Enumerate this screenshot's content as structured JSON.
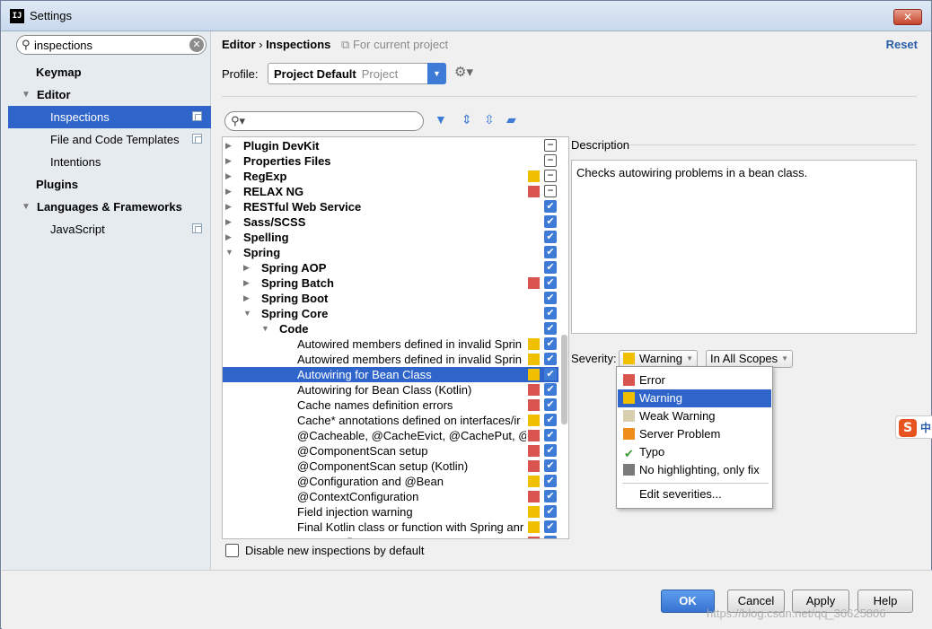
{
  "window": {
    "title": "Settings",
    "app_icon": "IJ",
    "close": "✕"
  },
  "left": {
    "search_value": "inspections",
    "items": [
      {
        "label": "Keymap"
      },
      {
        "label": "Editor"
      },
      {
        "label": "Inspections"
      },
      {
        "label": "File and Code Templates"
      },
      {
        "label": "Intentions"
      },
      {
        "label": "Plugins"
      },
      {
        "label": "Languages & Frameworks"
      },
      {
        "label": "JavaScript"
      }
    ]
  },
  "header": {
    "crumb_1": "Editor",
    "crumb_sep": "›",
    "crumb_2": "Inspections",
    "scope_note": "For current project",
    "reset": "Reset",
    "profile_label": "Profile:",
    "profile_value": "Project Default",
    "profile_kind": "Project"
  },
  "colors": {
    "error": "#d9534f",
    "warning": "#f0c000",
    "weak_warning": "#d8cfae",
    "server_problem": "#ee8c1c",
    "no_highlight": "#7a7a7a",
    "selection": "#2f65ca",
    "accent": "#3d7bd6"
  },
  "tree": [
    {
      "label": "Plugin DevKit",
      "sev": "",
      "check": "part"
    },
    {
      "label": "Properties Files",
      "sev": "",
      "check": "part"
    },
    {
      "label": "RegExp",
      "sev": "warning",
      "check": "part"
    },
    {
      "label": "RELAX NG",
      "sev": "error",
      "check": "part"
    },
    {
      "label": "RESTful Web Service",
      "sev": "",
      "check": "on"
    },
    {
      "label": "Sass/SCSS",
      "sev": "",
      "check": "on"
    },
    {
      "label": "Spelling",
      "sev": "",
      "check": "on"
    },
    {
      "label": "Spring",
      "sev": "",
      "check": "on"
    },
    {
      "label": "Spring AOP",
      "sev": "",
      "check": "on"
    },
    {
      "label": "Spring Batch",
      "sev": "error",
      "check": "on"
    },
    {
      "label": "Spring Boot",
      "sev": "",
      "check": "on"
    },
    {
      "label": "Spring Core",
      "sev": "",
      "check": "on"
    },
    {
      "label": "Code",
      "sev": "",
      "check": "on"
    },
    {
      "label": "Autowired members defined in invalid Sprin",
      "sev": "warning",
      "check": "on"
    },
    {
      "label": "Autowired members defined in invalid Sprin",
      "sev": "warning",
      "check": "on"
    },
    {
      "label": "Autowiring for Bean Class",
      "sev": "warning",
      "check": "on"
    },
    {
      "label": "Autowiring for Bean Class (Kotlin)",
      "sev": "error",
      "check": "on"
    },
    {
      "label": "Cache names definition errors",
      "sev": "error",
      "check": "on"
    },
    {
      "label": "Cache* annotations defined on interfaces/ir",
      "sev": "warning",
      "check": "on"
    },
    {
      "label": "@Cacheable, @CacheEvict, @CachePut, @C",
      "sev": "error",
      "check": "on"
    },
    {
      "label": "@ComponentScan setup",
      "sev": "error",
      "check": "on"
    },
    {
      "label": "@ComponentScan setup (Kotlin)",
      "sev": "error",
      "check": "on"
    },
    {
      "label": "@Configuration and @Bean",
      "sev": "warning",
      "check": "on"
    },
    {
      "label": "@ContextConfiguration",
      "sev": "error",
      "check": "on"
    },
    {
      "label": "Field injection warning",
      "sev": "warning",
      "check": "on"
    },
    {
      "label": "Final Kotlin class or function with Spring anr",
      "sev": "warning",
      "check": "on"
    },
    {
      "label": "Java Config",
      "sev": "error",
      "check": "on"
    }
  ],
  "disable_label": "Disable new inspections by default",
  "description": {
    "label": "Description",
    "text": "Checks autowiring problems in a bean class."
  },
  "severity": {
    "label": "Severity:",
    "value": "Warning",
    "scope": "In All Scopes",
    "options": [
      {
        "label": "Error"
      },
      {
        "label": "Warning"
      },
      {
        "label": "Weak Warning"
      },
      {
        "label": "Server Problem"
      },
      {
        "label": "Typo"
      },
      {
        "label": "No highlighting, only fix"
      }
    ],
    "edit": "Edit severities..."
  },
  "buttons": {
    "ok": "OK",
    "cancel": "Cancel",
    "apply": "Apply",
    "help": "Help"
  },
  "watermark": "https://blog.csdn.net/qq_36625806",
  "side_widget": {
    "s": "S",
    "z": "中"
  }
}
